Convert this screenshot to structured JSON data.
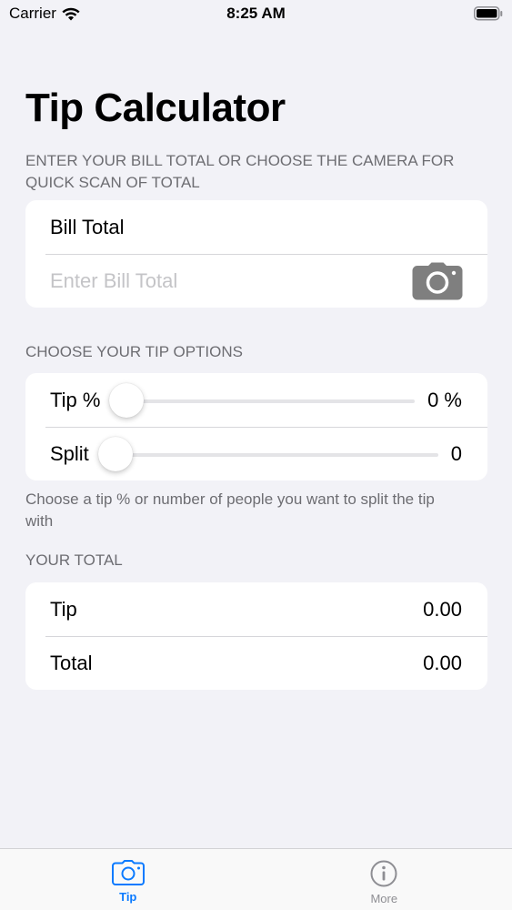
{
  "status_bar": {
    "carrier": "Carrier",
    "time": "8:25 AM"
  },
  "title": "Tip Calculator",
  "bill_section": {
    "header_line1": "ENTER YOUR BILL TOTAL OR CHOOSE THE CAMERA FOR",
    "header_line2": "QUICK SCAN OF TOTAL",
    "bill_label": "Bill Total",
    "input_placeholder": "Enter Bill Total",
    "camera_icon": "camera-icon"
  },
  "tip_section": {
    "header": "CHOOSE YOUR TIP OPTIONS",
    "tip_label": "Tip %",
    "tip_value": "0 %",
    "tip_slider_fraction": 0,
    "split_label": "Split",
    "split_value": "0",
    "split_slider_fraction": 0,
    "footnote_line1": "Choose a tip % or number of people you want to split the tip",
    "footnote_line2": "with"
  },
  "total_section": {
    "header": "YOUR TOTAL",
    "tip_label": "Tip",
    "tip_amount": "0.00",
    "total_label": "Total",
    "total_amount": "0.00"
  },
  "tab_bar": {
    "tabs": [
      {
        "label": "Tip",
        "icon": "camera-icon",
        "active": true
      },
      {
        "label": "More",
        "icon": "info-icon",
        "active": false
      }
    ]
  },
  "colors": {
    "accent": "#0a7aff",
    "background": "#f2f2f7",
    "secondary_text": "#6d6d72",
    "placeholder": "#c4c4c7",
    "camera_icon": "#7f7f7f"
  }
}
